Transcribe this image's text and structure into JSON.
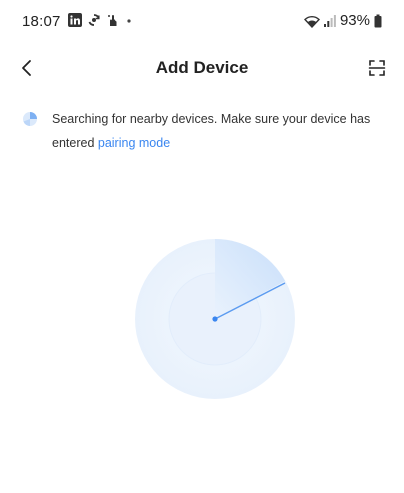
{
  "status_bar": {
    "time": "18:07",
    "battery": "93%",
    "icons_left": [
      "linkedin-icon",
      "sync-app-icon",
      "hand-icon",
      "dot-icon"
    ],
    "icons_right": [
      "wifi-icon",
      "signal-icon",
      "battery-icon"
    ]
  },
  "header": {
    "title": "Add Device",
    "back_icon": "chevron-left-icon",
    "scan_icon": "scan-icon"
  },
  "hint": {
    "text": "Searching for nearby devices. Make sure your device has entered ",
    "link": "pairing mode"
  },
  "colors": {
    "accent": "#3a86f0",
    "radar_light": "#eaf3fd",
    "radar_sweep": "#cfe2fb"
  }
}
